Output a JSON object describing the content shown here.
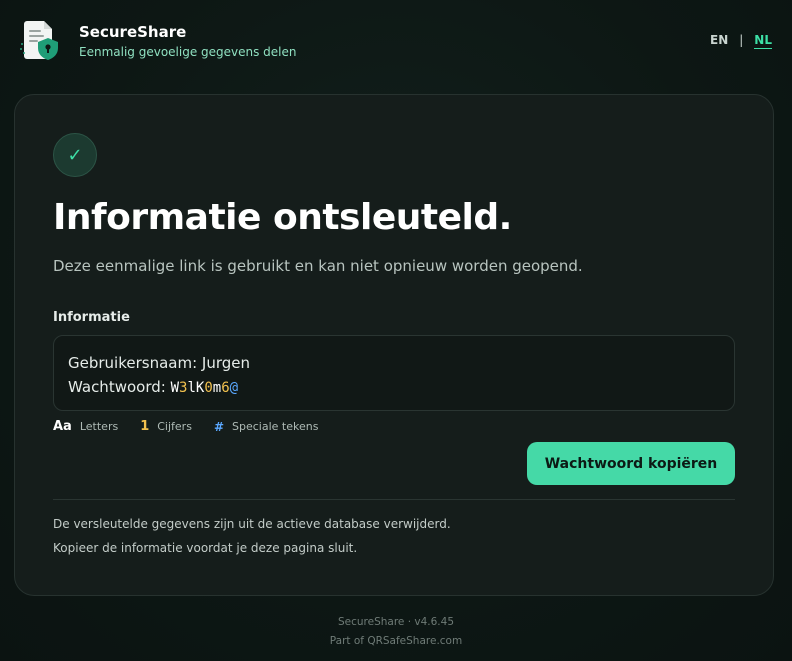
{
  "header": {
    "brand_title": "SecureShare",
    "brand_subtitle": "Eenmalig gevoelige gegevens delen",
    "lang_en": "EN",
    "lang_separator": "|",
    "lang_nl": "NL",
    "active_language": "NL"
  },
  "card": {
    "check_glyph": "✓",
    "title": "Informatie ontsleuteld.",
    "subtitle": "Deze eenmalige link is gebruikt en kan niet opnieuw worden geopend.",
    "field_label": "Informatie",
    "username_line": "Gebruikersnaam: Jurgen",
    "password_prefix": "Wachtwoord: ",
    "password_chars": [
      {
        "c": "W",
        "t": "l"
      },
      {
        "c": "3",
        "t": "d"
      },
      {
        "c": "l",
        "t": "l"
      },
      {
        "c": "K",
        "t": "l"
      },
      {
        "c": "0",
        "t": "d"
      },
      {
        "c": "m",
        "t": "l"
      },
      {
        "c": "6",
        "t": "d"
      },
      {
        "c": "@",
        "t": "s"
      }
    ],
    "legend": {
      "letters_mark": "Aa",
      "letters_label": "Letters",
      "digits_mark": "1",
      "digits_label": "Cijfers",
      "special_mark": "#",
      "special_label": "Speciale tekens"
    },
    "copy_button_label": "Wachtwoord kopiëren",
    "note_1": "De versleutelde gegevens zijn uit de actieve database verwijderd.",
    "note_2": "Kopieer de informatie voordat je deze pagina sluit."
  },
  "footer": {
    "line_1": "SecureShare · v4.6.45",
    "line_2": "Part of QRSafeShare.com"
  },
  "colors": {
    "accent": "#45d9a7",
    "digit": "#f2c14e",
    "special": "#5aa8ff",
    "background": "#0d1714",
    "card": "#151d1b"
  }
}
